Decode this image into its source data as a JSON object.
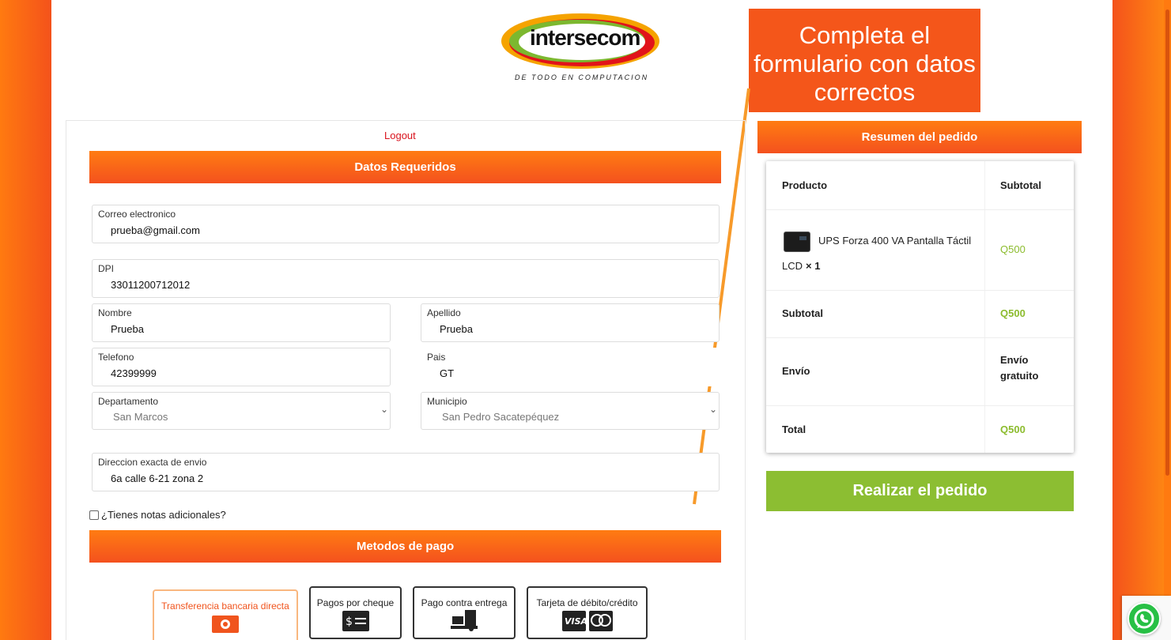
{
  "logo": {
    "word": "intersecom",
    "tagline": "DE TODO EN COMPUTACION"
  },
  "callout": {
    "lines": [
      "Completa el",
      "formulario con datos",
      "correctos"
    ]
  },
  "header": {
    "logout": "Logout"
  },
  "sections": {
    "required": "Datos Requeridos",
    "payment": "Metodos de pago",
    "summary": "Resumen del pedido"
  },
  "form": {
    "email": {
      "label": "Correo electronico",
      "value": "prueba@gmail.com"
    },
    "dpi": {
      "label": "DPI",
      "value": "33011200712012"
    },
    "first_name": {
      "label": "Nombre",
      "value": "Prueba"
    },
    "last_name": {
      "label": "Apellido",
      "value": "Prueba"
    },
    "phone": {
      "label": "Telefono",
      "value": "42399999"
    },
    "country": {
      "label": "Pais",
      "value": "GT"
    },
    "department": {
      "label": "Departamento",
      "value": "San Marcos"
    },
    "municipality": {
      "label": "Municipio",
      "value": "San Pedro Sacatepéquez"
    },
    "address": {
      "label": "Direccion exacta de envio",
      "value": "6a calle 6-21 zona 2"
    },
    "notes": "¿Tienes notas adicionales?"
  },
  "payment_methods": [
    {
      "label": "Transferencia bancaria directa",
      "icon": "cash-icon",
      "active": true
    },
    {
      "label": "Pagos por cheque",
      "icon": "check-icon",
      "active": false
    },
    {
      "label": "Pago contra entrega",
      "icon": "delivery-icon",
      "active": false
    },
    {
      "label": "Tarjeta de débito/crédito",
      "icon": "card-icon",
      "active": false,
      "brands": "VISA"
    }
  ],
  "summary": {
    "col_product": "Producto",
    "col_subtotal": "Subtotal",
    "product_name": "UPS Forza 400 VA Pantalla Táctil",
    "product_name_2": "LCD",
    "product_qty": "× 1",
    "product_price": "Q500",
    "subtotal_label": "Subtotal",
    "subtotal_value": "Q500",
    "shipping_label": "Envío",
    "shipping_value_1": "Envío",
    "shipping_value_2": "gratuito",
    "total_label": "Total",
    "total_value": "Q500"
  },
  "order_button": "Realizar el pedido",
  "colors": {
    "accent": "#f4561a",
    "bar_top": "#ff7c12",
    "green": "#8cbc2e"
  }
}
